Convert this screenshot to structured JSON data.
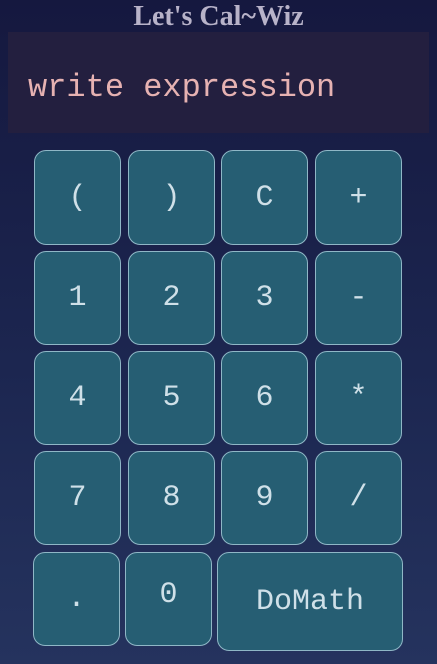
{
  "app": {
    "title": "Let's Cal~Wiz"
  },
  "display": {
    "placeholder": "write expression",
    "value": ""
  },
  "keypad": {
    "open_paren": "(",
    "close_paren": ")",
    "clear": "C",
    "plus": "+",
    "one": "1",
    "two": "2",
    "three": "3",
    "minus": "-",
    "four": "4",
    "five": "5",
    "six": "6",
    "multiply": "*",
    "seven": "7",
    "eight": "8",
    "nine": "9",
    "divide": "/",
    "decimal": ".",
    "zero": "0",
    "domath": "DoMath"
  }
}
